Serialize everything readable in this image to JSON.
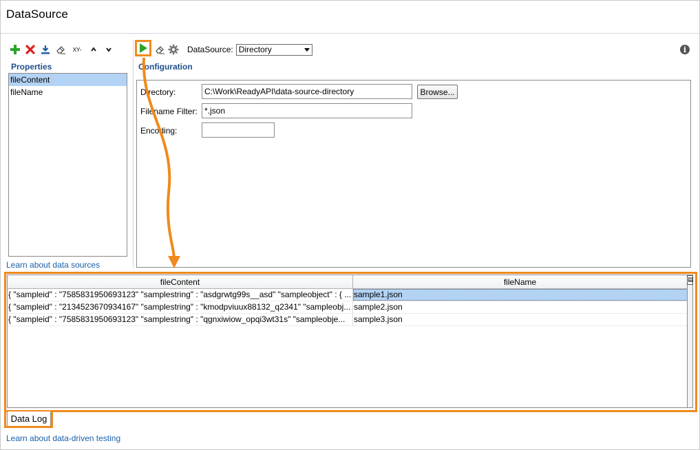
{
  "window": {
    "title": "DataSource"
  },
  "properties": {
    "toolbar_icons": [
      "add-icon",
      "delete-icon",
      "import-icon",
      "clear-icon",
      "xy-icon",
      "move-up-icon",
      "move-down-icon"
    ],
    "xy_label": "XY-",
    "title": "Properties",
    "items": [
      {
        "label": "fileContent",
        "selected": true
      },
      {
        "label": "fileName",
        "selected": false
      }
    ],
    "learn_link": "Learn about data sources"
  },
  "datasource_toolbar": {
    "icons": [
      "run-icon",
      "clear-icon",
      "settings-icon"
    ],
    "datasource_label": "DataSource:",
    "datasource_value": "Directory"
  },
  "configuration": {
    "title": "Configuration",
    "directory_label": "Directory:",
    "directory_value": "C:\\Work\\ReadyAPI\\data-source-directory",
    "browse_label": "Browse...",
    "filter_label": "Filename Filter:",
    "filter_value": "*.json",
    "encoding_label": "Encoding:",
    "encoding_value": ""
  },
  "data_log": {
    "columns": [
      "fileContent",
      "fileName"
    ],
    "rows": [
      {
        "content": "{   \"sampleid\" : \"7585831950693123\"   \"samplestring\" : \"asdgrwtg99s__asd\"   \"sampleobject\" : {   ...",
        "name": "sample1.json",
        "selected": true
      },
      {
        "content": "{   \"sampleid\" : \"2134523670934167\"   \"samplestring\" : \"kmodpviuux88132_q2341\"   \"sampleobj...",
        "name": "sample2.json",
        "selected": false
      },
      {
        "content": "{   \"sampleid\" : \"7585831950693123\"   \"samplestring\" : \"qgnxiwiow_opqi3wt31s\"   \"sampleobje...",
        "name": "sample3.json",
        "selected": false
      }
    ],
    "tab_label": "Data Log",
    "learn_link": "Learn about data-driven testing"
  },
  "colors": {
    "accent": "#f08a1c",
    "link": "#1a5fa8",
    "heading": "#1f4e8c",
    "selection": "#b3d3f5"
  }
}
